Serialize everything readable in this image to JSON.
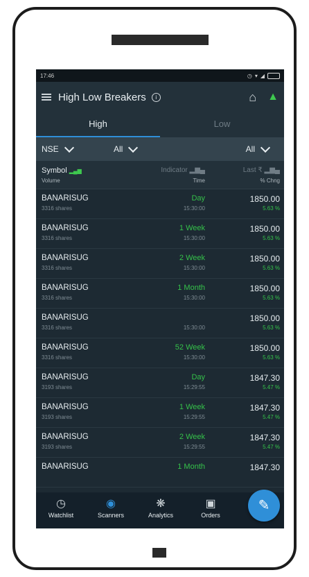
{
  "status": {
    "time": "17:46"
  },
  "app": {
    "title": "High Low Breakers"
  },
  "tabs": [
    {
      "label": "High"
    },
    {
      "label": "Low"
    }
  ],
  "filters": {
    "exchange": "NSE",
    "filter2": "All",
    "filter3": "All"
  },
  "table_header": {
    "symbol": "Symbol",
    "volume": "Volume",
    "indicator": "Indicator",
    "time": "Time",
    "last": "Last ₹",
    "change": "% Chng"
  },
  "rows": [
    {
      "symbol": "BANARISUG",
      "volume": "3316 shares",
      "indicator": "Day",
      "time": "15:30:00",
      "price": "1850.00",
      "change": "5.63 %"
    },
    {
      "symbol": "BANARISUG",
      "volume": "3316 shares",
      "indicator": "1 Week",
      "time": "15:30:00",
      "price": "1850.00",
      "change": "5.63 %"
    },
    {
      "symbol": "BANARISUG",
      "volume": "3316 shares",
      "indicator": "2 Week",
      "time": "15:30:00",
      "price": "1850.00",
      "change": "5.63 %"
    },
    {
      "symbol": "BANARISUG",
      "volume": "3316 shares",
      "indicator": "1 Month",
      "time": "15:30:00",
      "price": "1850.00",
      "change": "5.63 %"
    },
    {
      "symbol": "BANARISUG",
      "volume": "3316 shares",
      "indicator": "",
      "time": "15:30:00",
      "price": "1850.00",
      "change": "5.63 %"
    },
    {
      "symbol": "BANARISUG",
      "volume": "3316 shares",
      "indicator": "52 Week",
      "time": "15:30:00",
      "price": "1850.00",
      "change": "5.63 %"
    },
    {
      "symbol": "BANARISUG",
      "volume": "3193 shares",
      "indicator": "Day",
      "time": "15:29:55",
      "price": "1847.30",
      "change": "5.47 %"
    },
    {
      "symbol": "BANARISUG",
      "volume": "3193 shares",
      "indicator": "1 Week",
      "time": "15:29:55",
      "price": "1847.30",
      "change": "5.47 %"
    },
    {
      "symbol": "BANARISUG",
      "volume": "3193 shares",
      "indicator": "2 Week",
      "time": "15:29:55",
      "price": "1847.30",
      "change": "5.47 %"
    },
    {
      "symbol": "BANARISUG",
      "volume": "",
      "indicator": "1 Month",
      "time": "",
      "price": "1847.30",
      "change": ""
    }
  ],
  "nav": [
    {
      "label": "Watchlist",
      "icon": "watchlist-icon"
    },
    {
      "label": "Scanners",
      "icon": "scanners-icon"
    },
    {
      "label": "Analytics",
      "icon": "analytics-icon"
    },
    {
      "label": "Orders",
      "icon": "orders-icon"
    }
  ],
  "colors": {
    "accent": "#2f8fd8",
    "positive": "#35c24a",
    "background": "#1d2a33"
  }
}
